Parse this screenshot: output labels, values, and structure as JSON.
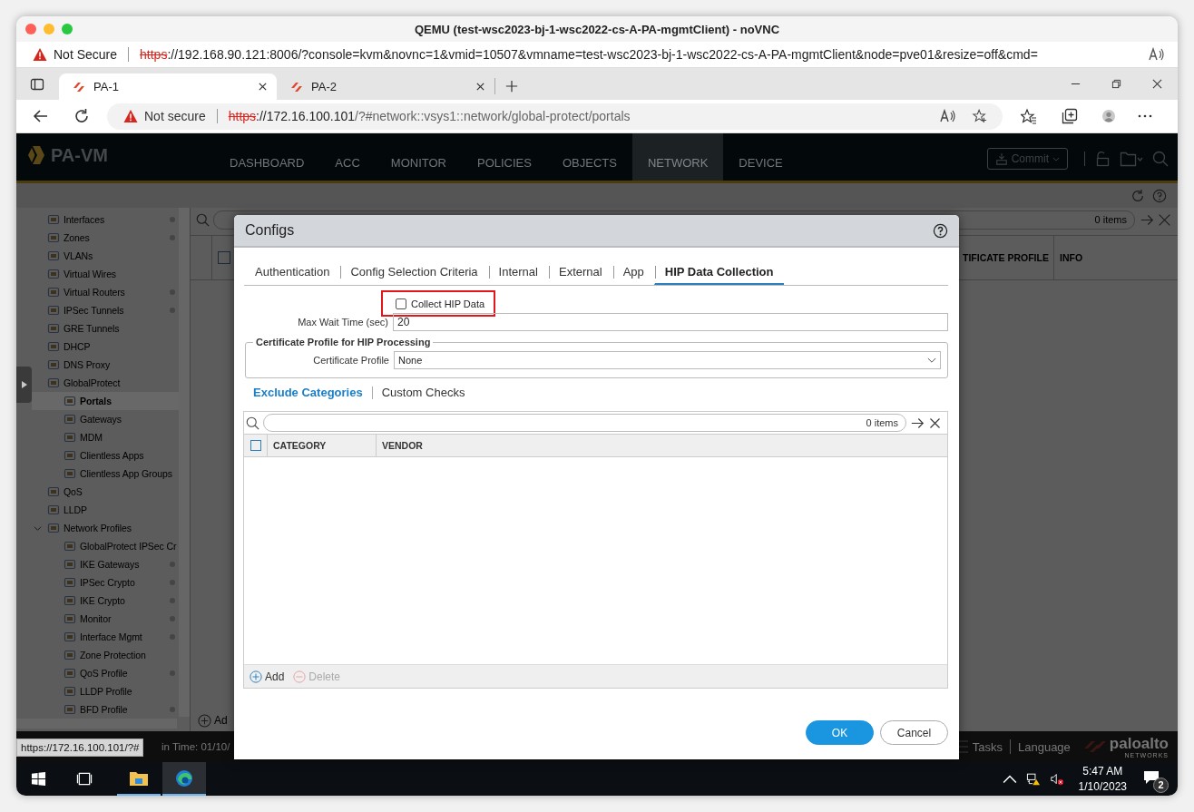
{
  "window": {
    "title": "QEMU (test-wsc2023-bj-1-wsc2022-cs-A-PA-mgmtClient) - noVNC"
  },
  "vnc_address_bar": {
    "security": "Not Secure",
    "scheme": "https",
    "url": "://192.168.90.121:8006/?console=kvm&novnc=1&vmid=10507&vmname=test-wsc2023-bj-1-wsc2022-cs-A-PA-mgmtClient&node=pve01&resize=off&cmd=",
    "secure": false
  },
  "browser": {
    "tabs": [
      {
        "label": "PA-1",
        "selected": true
      },
      {
        "label": "PA-2",
        "selected": false
      }
    ],
    "address_bar": {
      "security": "Not secure",
      "scheme": "https",
      "host": "://172.16.100.101",
      "path": "/?#network::vsys1::network/global-protect/portals",
      "secure": false
    }
  },
  "app": {
    "logo": "PA-VM",
    "nav": [
      {
        "label": "DASHBOARD",
        "selected": false
      },
      {
        "label": "ACC",
        "selected": false
      },
      {
        "label": "MONITOR",
        "selected": false
      },
      {
        "label": "POLICIES",
        "selected": false
      },
      {
        "label": "OBJECTS",
        "selected": false
      },
      {
        "label": "NETWORK",
        "selected": true
      },
      {
        "label": "DEVICE",
        "selected": false
      }
    ],
    "commit_button": "Commit",
    "sidebar": {
      "items": [
        {
          "label": "Interfaces",
          "dot": true,
          "selected": false
        },
        {
          "label": "Zones",
          "dot": true,
          "selected": false
        },
        {
          "label": "VLANs",
          "dot": false,
          "selected": false
        },
        {
          "label": "Virtual Wires",
          "dot": false,
          "selected": false
        },
        {
          "label": "Virtual Routers",
          "dot": true,
          "selected": false
        },
        {
          "label": "IPSec Tunnels",
          "dot": true,
          "selected": false
        },
        {
          "label": "GRE Tunnels",
          "dot": false,
          "selected": false
        },
        {
          "label": "DHCP",
          "dot": false,
          "selected": false
        },
        {
          "label": "DNS Proxy",
          "dot": false,
          "selected": false
        },
        {
          "label": "GlobalProtect",
          "dot": false,
          "selected": false,
          "children": [
            {
              "label": "Portals",
              "dot": false,
              "selected": true
            },
            {
              "label": "Gateways",
              "dot": false,
              "selected": false
            },
            {
              "label": "MDM",
              "dot": false,
              "selected": false
            },
            {
              "label": "Clientless Apps",
              "dot": false,
              "selected": false
            },
            {
              "label": "Clientless App Groups",
              "dot": false,
              "selected": false
            }
          ]
        },
        {
          "label": "QoS",
          "dot": false,
          "selected": false
        },
        {
          "label": "LLDP",
          "dot": false,
          "selected": false
        },
        {
          "label": "Network Profiles",
          "dot": false,
          "selected": false,
          "expanded": true,
          "children": [
            {
              "label": "GlobalProtect IPSec Cr",
              "dot": false,
              "selected": false
            },
            {
              "label": "IKE Gateways",
              "dot": true,
              "selected": false
            },
            {
              "label": "IPSec Crypto",
              "dot": true,
              "selected": false
            },
            {
              "label": "IKE Crypto",
              "dot": true,
              "selected": false
            },
            {
              "label": "Monitor",
              "dot": true,
              "selected": false
            },
            {
              "label": "Interface Mgmt",
              "dot": true,
              "selected": false
            },
            {
              "label": "Zone Protection",
              "dot": false,
              "selected": false
            },
            {
              "label": "QoS Profile",
              "dot": true,
              "selected": false
            },
            {
              "label": "LLDP Profile",
              "dot": false,
              "selected": false
            },
            {
              "label": "BFD Profile",
              "dot": true,
              "selected": false
            }
          ]
        }
      ]
    },
    "table": {
      "count": "0 items",
      "select_all": {
        "checked": false
      },
      "columns": [
        "TIFICATE PROFILE",
        "INFO"
      ],
      "add_button": "Ad"
    },
    "footer": {
      "time": "in Time: 01/10/",
      "tasks": "Tasks",
      "language": "Language",
      "brand": "paloalto",
      "brand_sub": "NETWORKS"
    },
    "status_url": "https://172.16.100.101/?#"
  },
  "dialog": {
    "title": "Configs",
    "tabs": [
      {
        "label": "Authentication",
        "selected": false
      },
      {
        "label": "Config Selection Criteria",
        "selected": false
      },
      {
        "label": "Internal",
        "selected": false
      },
      {
        "label": "External",
        "selected": false
      },
      {
        "label": "App",
        "selected": false
      },
      {
        "label": "HIP Data Collection",
        "selected": true
      }
    ],
    "collect_hip": {
      "label": "Collect HIP Data",
      "checked": false,
      "highlighted": true
    },
    "max_wait": {
      "label": "Max Wait Time (sec)",
      "value": "20"
    },
    "cert_group": {
      "legend": "Certificate Profile for HIP Processing",
      "label": "Certificate Profile",
      "value": "None"
    },
    "subtabs": [
      {
        "label": "Exclude Categories",
        "selected": true
      },
      {
        "label": "Custom Checks",
        "selected": false
      }
    ],
    "grid": {
      "count": "0 items",
      "select_all": {
        "checked": false
      },
      "columns": [
        "CATEGORY",
        "VENDOR"
      ],
      "actions": [
        {
          "label": "Add",
          "disabled": false
        },
        {
          "label": "Delete",
          "disabled": true
        }
      ]
    },
    "buttons": [
      {
        "label": "OK",
        "kind": "primary"
      },
      {
        "label": "Cancel",
        "kind": "secondary"
      }
    ]
  },
  "taskbar": {
    "time": "5:47 AM",
    "date": "1/10/2023",
    "notifications": "2"
  }
}
